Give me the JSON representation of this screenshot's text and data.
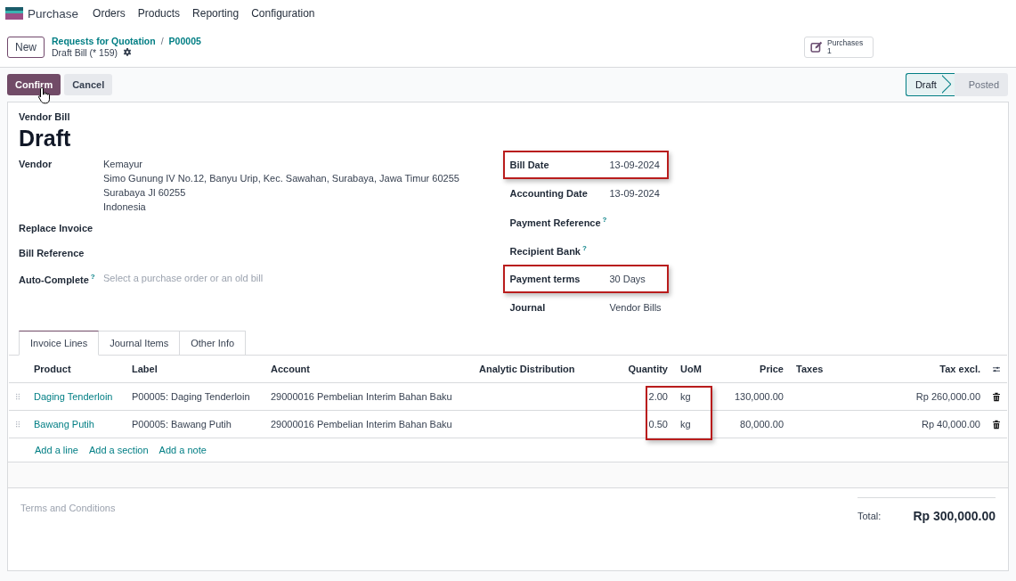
{
  "app": {
    "name": "Purchase",
    "menu": [
      "Orders",
      "Products",
      "Reporting",
      "Configuration"
    ]
  },
  "control_panel": {
    "new_button": "New",
    "breadcrumbs": [
      "Requests for Quotation",
      "P00005"
    ],
    "breadcrumb_separator": "/",
    "record": "Draft Bill (* 159)",
    "smart_button": {
      "label": "Purchases",
      "count": "1"
    }
  },
  "actions": [
    "Confirm",
    "Cancel"
  ],
  "statuses": [
    {
      "label": "Draft",
      "selected": true
    },
    {
      "label": "Posted",
      "selected": false
    }
  ],
  "form": {
    "type": "Vendor Bill",
    "title": "Draft",
    "left_fields": [
      {
        "label": "Vendor",
        "value_lines": [
          "Kemayur",
          "Simo Gunung IV No.12, Banyu Urip, Kec. Sawahan, Surabaya, Jawa Timur 60255",
          "Surabaya JI 60255",
          "Indonesia"
        ]
      },
      {
        "label": "Replace Invoice"
      },
      {
        "label": "Bill Reference"
      },
      {
        "label": "Auto-Complete",
        "tooltip": "?",
        "placeholder": "Select a purchase order or an old bill"
      }
    ],
    "right_fields": [
      {
        "label": "Bill Date",
        "value": "13-09-2024",
        "highlighted": true
      },
      {
        "label": "Accounting Date",
        "value": "13-09-2024"
      },
      {
        "label": "Payment Reference",
        "tooltip": "?"
      },
      {
        "label": "Recipient Bank",
        "tooltip": "?"
      },
      {
        "label": "Payment terms",
        "value": "30 Days",
        "highlighted": true
      },
      {
        "label": "Journal",
        "value": "Vendor Bills"
      }
    ]
  },
  "tabs": [
    {
      "label": "Invoice Lines",
      "selected": true
    },
    {
      "label": "Journal Items",
      "selected": false
    },
    {
      "label": "Other Info",
      "selected": false
    }
  ],
  "table": {
    "columns": [
      {
        "label": "Product"
      },
      {
        "label": "Label"
      },
      {
        "label": "Account"
      },
      {
        "label": "Analytic Distribution"
      },
      {
        "label": "Quantity",
        "highlighted": true
      },
      {
        "label": "UoM",
        "highlighted": true
      },
      {
        "label": "Price"
      },
      {
        "label": "Taxes"
      },
      {
        "label": "Tax excl."
      }
    ],
    "rows": [
      {
        "product": "Daging Tenderloin",
        "label": "P00005: Daging Tenderloin",
        "account": "29000016 Pembelian Interim Bahan Baku",
        "quantity": "2.00",
        "uom": "kg",
        "price": "130,000.00",
        "tax_excl": "Rp 260,000.00"
      },
      {
        "product": "Bawang Putih",
        "label": "P00005: Bawang Putih",
        "account": "29000016 Pembelian Interim Bahan Baku",
        "quantity": "0.50",
        "uom": "kg",
        "price": "80,000.00",
        "tax_excl": "Rp 40,000.00"
      }
    ],
    "add_links": [
      "Add a line",
      "Add a section",
      "Add a note"
    ]
  },
  "footer": {
    "terms_placeholder": "Terms and Conditions",
    "total_label": "Total:",
    "total_value": "Rp 300,000.00"
  }
}
